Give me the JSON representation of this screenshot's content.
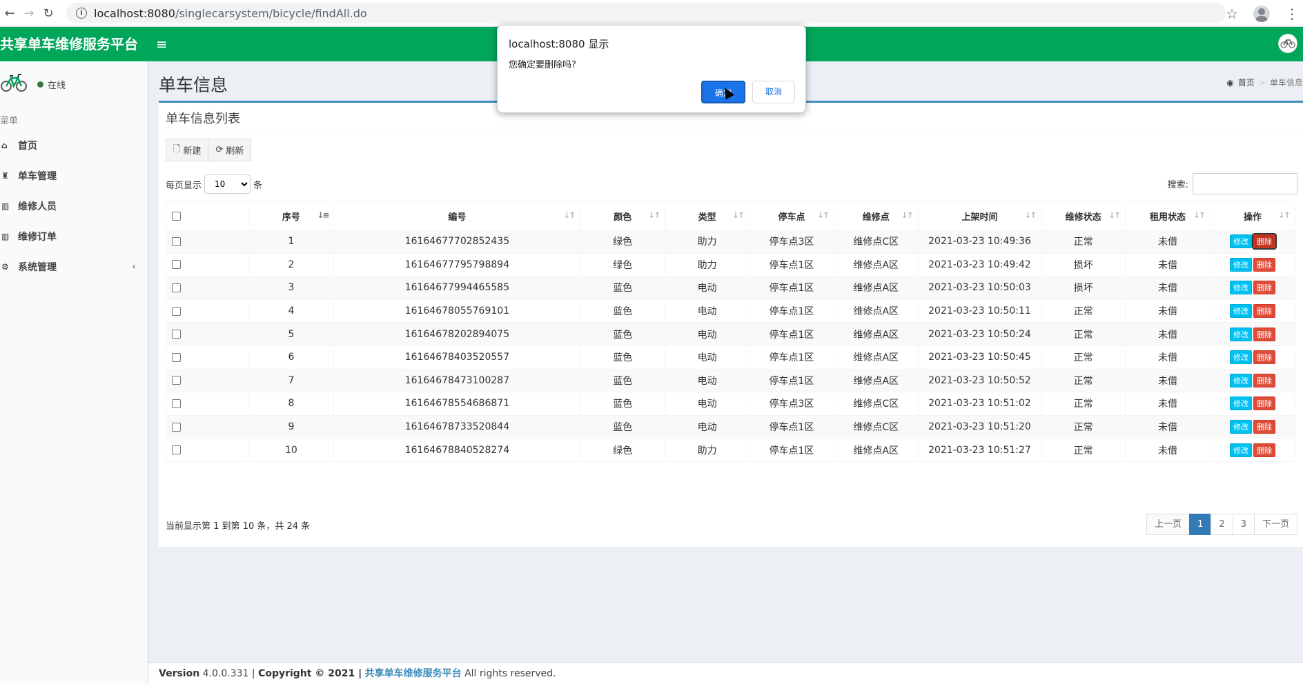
{
  "browser": {
    "url_host": "localhost:8080",
    "url_path": "/singlecarsystem/bicycle/findAll.do"
  },
  "header": {
    "logo": "共享单车维修服务平台"
  },
  "sidebar": {
    "status": "在线",
    "menu_header": "菜单",
    "items": [
      {
        "label": "首页",
        "icon": "home-icon"
      },
      {
        "label": "单车管理",
        "icon": "trophy-icon"
      },
      {
        "label": "维修人员",
        "icon": "bar-chart-icon"
      },
      {
        "label": "维修订单",
        "icon": "bar-chart-icon"
      },
      {
        "label": "系统管理",
        "icon": "gear-icon"
      }
    ]
  },
  "page": {
    "title": "单车信息",
    "breadcrumb_home": "首页",
    "breadcrumb_current": "单车信息"
  },
  "box": {
    "title": "单车信息列表",
    "new_label": "新建",
    "refresh_label": "刷新",
    "length_prefix": "每页显示",
    "length_value": "10",
    "length_suffix": "条",
    "search_label": "搜索:"
  },
  "table": {
    "columns": [
      "序号",
      "编号",
      "颜色",
      "类型",
      "停车点",
      "维修点",
      "上架时间",
      "维修状态",
      "租用状态",
      "操作"
    ],
    "edit_label": "修改",
    "delete_label": "删除",
    "rows": [
      [
        "1",
        "16164677702852435",
        "绿色",
        "助力",
        "停车点3区",
        "维修点C区",
        "2021-03-23 10:49:36",
        "正常",
        "未借"
      ],
      [
        "2",
        "16164677795798894",
        "绿色",
        "助力",
        "停车点1区",
        "维修点A区",
        "2021-03-23 10:49:42",
        "损坏",
        "未借"
      ],
      [
        "3",
        "16164677994465585",
        "蓝色",
        "电动",
        "停车点1区",
        "维修点A区",
        "2021-03-23 10:50:03",
        "损坏",
        "未借"
      ],
      [
        "4",
        "16164678055769101",
        "蓝色",
        "电动",
        "停车点1区",
        "维修点A区",
        "2021-03-23 10:50:11",
        "正常",
        "未借"
      ],
      [
        "5",
        "16164678202894075",
        "蓝色",
        "电动",
        "停车点1区",
        "维修点A区",
        "2021-03-23 10:50:24",
        "正常",
        "未借"
      ],
      [
        "6",
        "16164678403520557",
        "蓝色",
        "电动",
        "停车点1区",
        "维修点A区",
        "2021-03-23 10:50:45",
        "正常",
        "未借"
      ],
      [
        "7",
        "16164678473100287",
        "蓝色",
        "电动",
        "停车点1区",
        "维修点A区",
        "2021-03-23 10:50:52",
        "正常",
        "未借"
      ],
      [
        "8",
        "16164678554686871",
        "蓝色",
        "电动",
        "停车点3区",
        "维修点C区",
        "2021-03-23 10:51:02",
        "正常",
        "未借"
      ],
      [
        "9",
        "16164678733520844",
        "蓝色",
        "电动",
        "停车点1区",
        "维修点C区",
        "2021-03-23 10:51:20",
        "正常",
        "未借"
      ],
      [
        "10",
        "16164678840528274",
        "绿色",
        "助力",
        "停车点1区",
        "维修点A区",
        "2021-03-23 10:51:27",
        "正常",
        "未借"
      ]
    ],
    "info": "当前显示第 1 到第 10 条，共 24 条"
  },
  "pager": {
    "prev": "上一页",
    "pages": [
      "1",
      "2",
      "3"
    ],
    "current": "1",
    "next": "下一页"
  },
  "footer": {
    "version_label": "Version",
    "version": "4.0.0.331",
    "copyright": "Copyright © 2021 |",
    "brand": "共享单车维修服务平台",
    "rights": "All rights reserved."
  },
  "dialog": {
    "title": "localhost:8080 显示",
    "message": "您确定要删除吗?",
    "ok": "确定",
    "cancel": "取消"
  },
  "colors": {
    "header": "#00a65a",
    "box_border": "#3c8dbc",
    "edit_button": "#00c0ef",
    "delete_button": "#dd4b39",
    "pager_active": "#337ab7",
    "dialog_ok": "#1a73e8"
  }
}
